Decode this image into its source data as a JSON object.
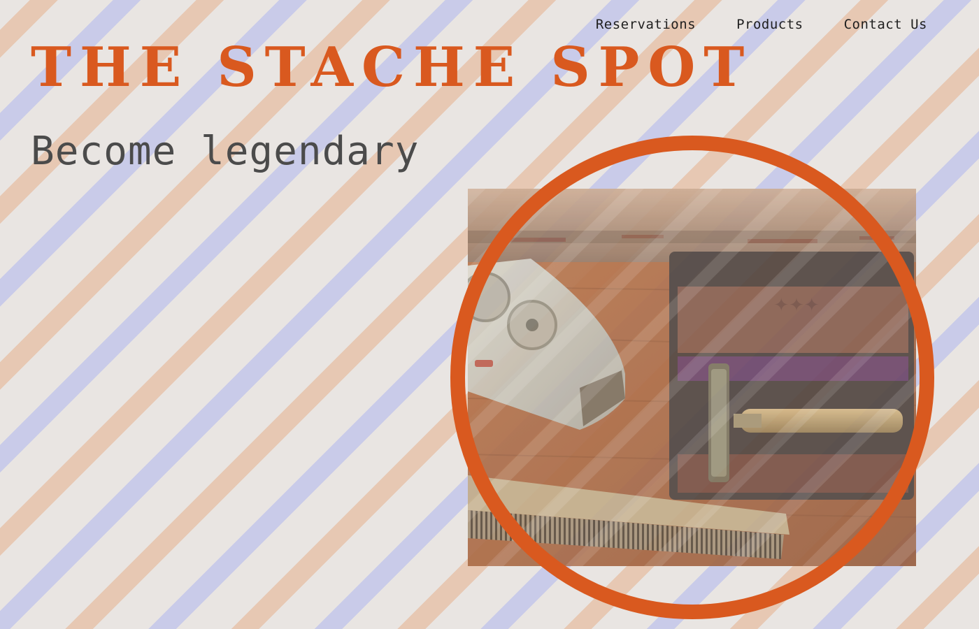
{
  "nav": {
    "items": [
      "Reservations",
      "Products",
      "Contact Us"
    ]
  },
  "brand": {
    "title": "THE STACHE SPOT"
  },
  "hero": {
    "tagline": "Become legendary",
    "photo_subject": "vintage barber tools: electric shaver, safety razor in box, metal comb"
  },
  "colors": {
    "accent": "#d9591f",
    "background": "#e9e5e2",
    "stripe_peach": "#e7c8b3",
    "stripe_lavender": "#c9cbe9",
    "tagline_text": "#4b4b4b",
    "nav_text": "#1f1f1f"
  }
}
